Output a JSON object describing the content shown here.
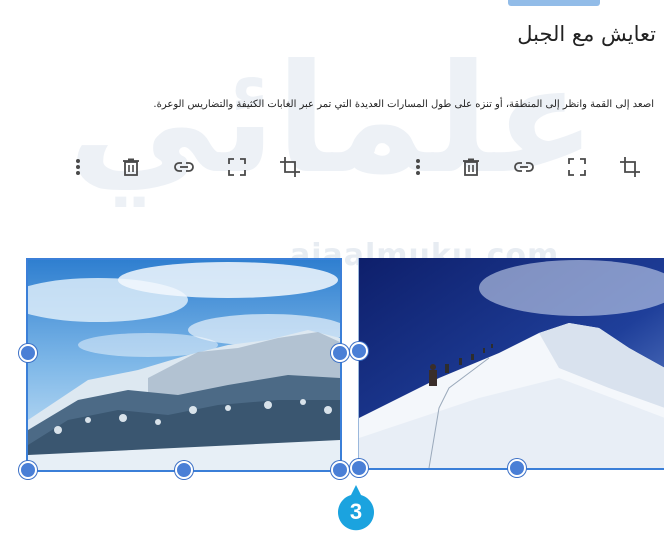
{
  "watermark": {
    "main": "علمائي",
    "sub": "ajaalmuku.com"
  },
  "section": {
    "title": "تعايش مع الجبل",
    "description": "اصعد إلى القمة وانظر إلى المنطقة، أو تنزه على طول المسارات العديدة التي تمر عبر الغابات الكثيفة والتضاريس الوعرة."
  },
  "image_toolbar_icons": [
    "crop-icon",
    "fullscreen-icon",
    "link-icon",
    "delete-icon",
    "more-vert-icon"
  ],
  "images": [
    {
      "name": "mountain-forest-snow-image",
      "selected": true
    },
    {
      "name": "climbers-snow-ridge-image",
      "selected": true
    }
  ],
  "step_badge": {
    "number": "3",
    "color": "#1ba3df"
  },
  "colors": {
    "accent": "#3b7fd8",
    "handle": "#4a7fd6",
    "icon": "#4a4a4a"
  }
}
